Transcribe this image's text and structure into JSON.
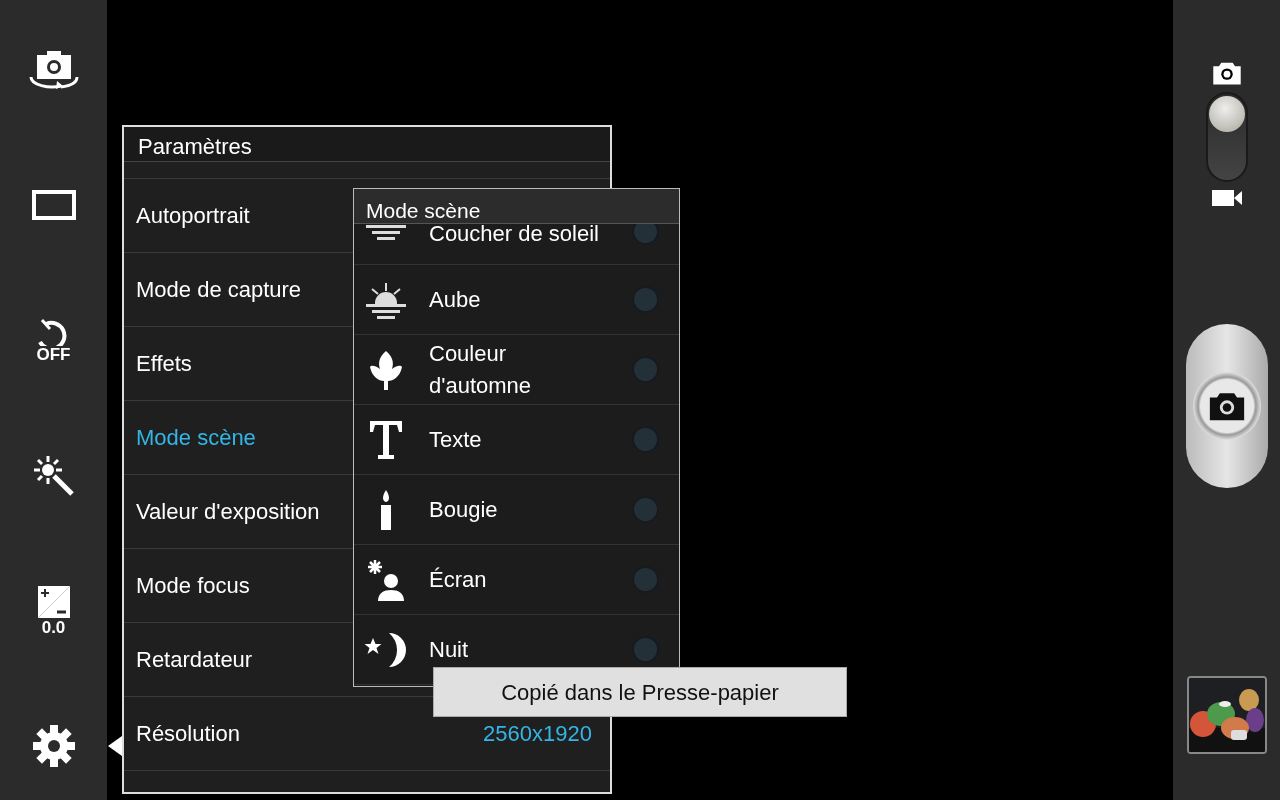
{
  "left_toolbar": [
    {
      "kind": "self-portrait",
      "selected": false
    },
    {
      "kind": "capture-mode",
      "selected": false
    },
    {
      "kind": "timer",
      "label": "OFF",
      "selected": false
    },
    {
      "kind": "effects",
      "selected": false
    },
    {
      "kind": "exposure",
      "label": "0.0",
      "selected": false
    },
    {
      "kind": "settings",
      "selected": true
    }
  ],
  "settings": {
    "title": "Paramètres",
    "items": [
      {
        "label": "Autoportrait",
        "selected": false
      },
      {
        "label": "Mode de capture",
        "selected": false
      },
      {
        "label": "Effets",
        "selected": false
      },
      {
        "label": "Mode scène",
        "selected": true
      },
      {
        "label": "Valeur d'exposition",
        "selected": false
      },
      {
        "label": "Mode focus",
        "selected": false
      },
      {
        "label": "Retardateur",
        "selected": false
      },
      {
        "label": "Résolution",
        "value": "2560x1920",
        "selected": false
      }
    ]
  },
  "scene_menu": {
    "title": "Mode scène",
    "items": [
      {
        "kind": "sunset",
        "label": "Coucher de soleil",
        "selected": false
      },
      {
        "kind": "sunrise",
        "label": "Aube",
        "selected": false
      },
      {
        "kind": "leaf",
        "label": "Couleur d'automne",
        "selected": false
      },
      {
        "kind": "text",
        "label": "Texte",
        "selected": false
      },
      {
        "kind": "candle",
        "label": "Bougie",
        "selected": false
      },
      {
        "kind": "backlight",
        "label": "Écran",
        "selected": false
      },
      {
        "kind": "night",
        "label": "Nuit",
        "selected": false
      }
    ]
  },
  "toast": "Copié dans le Presse-papier",
  "mode_switch": {
    "kind": "camera"
  }
}
